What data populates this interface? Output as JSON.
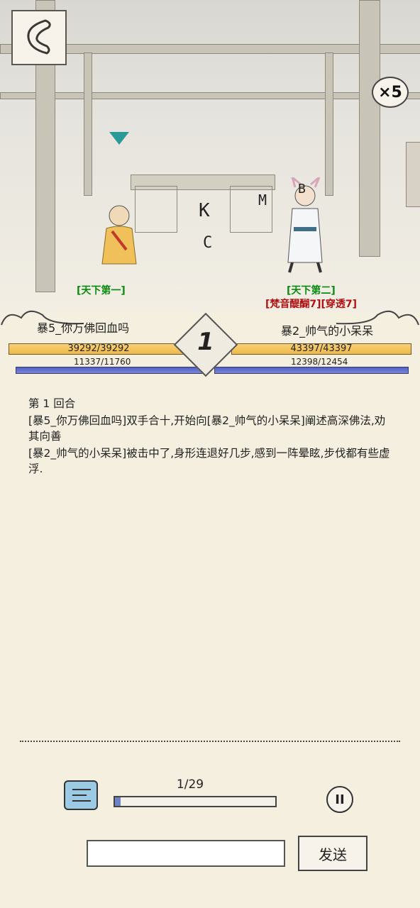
{
  "top_bar": {
    "back_label": "<",
    "speed_multiplier": "×5"
  },
  "battle": {
    "left": {
      "title": "[天下第一]",
      "name": "暴5_你万佛回血吗",
      "hp_text": "39292/39292",
      "hp_fraction": 1.0,
      "mp_text": "11337/11760",
      "mp_fraction": 0.964
    },
    "right": {
      "title": "[天下第二]",
      "buffs": "[梵音醍醐7][穿透7]",
      "name": "暴2_帅气的小呆呆",
      "hp_text": "43397/43397",
      "hp_fraction": 1.0,
      "mp_text": "12398/12454",
      "mp_fraction": 0.995
    },
    "round_number": "1",
    "floating_letters": [
      "K",
      "C",
      "M",
      "B"
    ]
  },
  "log": {
    "lines": [
      "第 1 回合",
      "[暴5_你万佛回血吗]双手合十,开始向[暴2_帅气的小呆呆]阐述高深佛法,劝其向善",
      "[暴2_帅气的小呆呆]被击中了,身形连退好几步,感到一阵晕眩,步伐都有些虚浮."
    ]
  },
  "controls": {
    "progress_text": "1/29",
    "progress_fraction": 0.034,
    "pause_label": "II",
    "input_placeholder": "",
    "send_label": "发送"
  },
  "colors": {
    "hp": "#f0b848",
    "mp": "#5160c4",
    "title_green": "#0a8a10",
    "buff_red": "#b01010"
  }
}
